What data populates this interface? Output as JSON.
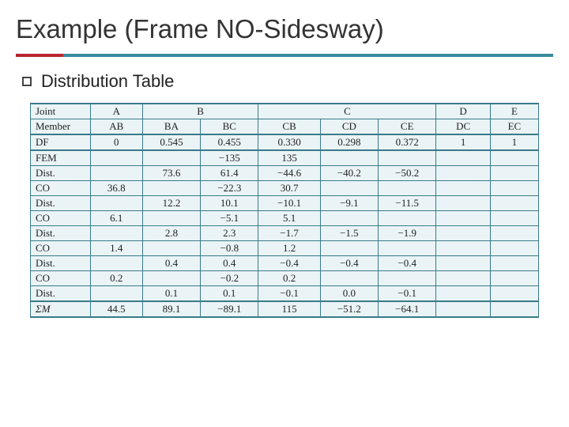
{
  "title": "Example (Frame NO-Sidesway)",
  "bullet": "Distribution Table",
  "headers": {
    "joint": "Joint",
    "member": "Member",
    "df": "DF",
    "fem": "FEM",
    "dist": "Dist.",
    "co": "CO",
    "sum": "ΣM"
  },
  "joints": {
    "a": "A",
    "b": "B",
    "c": "C",
    "d": "D",
    "e": "E"
  },
  "members": {
    "ab": "AB",
    "ba": "BA",
    "bc": "BC",
    "cb": "CB",
    "cd": "CD",
    "ce": "CE",
    "dc": "DC",
    "ec": "EC"
  },
  "df": {
    "ab": "0",
    "ba": "0.545",
    "bc": "0.455",
    "cb": "0.330",
    "cd": "0.298",
    "ce": "0.372",
    "dc": "1",
    "ec": "1"
  },
  "fem": {
    "bc": "−135",
    "cb": "135"
  },
  "dist1": {
    "ba": "73.6",
    "bc": "61.4",
    "cb": "−44.6",
    "cd": "−40.2",
    "ce": "−50.2"
  },
  "co1": {
    "ab": "36.8",
    "bc": "−22.3",
    "cb": "30.7"
  },
  "dist2": {
    "ba": "12.2",
    "bc": "10.1",
    "cb": "−10.1",
    "cd": "−9.1",
    "ce": "−11.5"
  },
  "co2": {
    "ab": "6.1",
    "bc": "−5.1",
    "cb": "5.1"
  },
  "dist3": {
    "ba": "2.8",
    "bc": "2.3",
    "cb": "−1.7",
    "cd": "−1.5",
    "ce": "−1.9"
  },
  "co3": {
    "ab": "1.4",
    "bc": "−0.8",
    "cb": "1.2"
  },
  "dist4": {
    "ba": "0.4",
    "bc": "0.4",
    "cb": "−0.4",
    "cd": "−0.4",
    "ce": "−0.4"
  },
  "co4": {
    "ab": "0.2",
    "bc": "−0.2",
    "cb": "0.2"
  },
  "dist5": {
    "ba": "0.1",
    "bc": "0.1",
    "cb": "−0.1",
    "cd": "0.0",
    "ce": "−0.1"
  },
  "summ": {
    "ab": "44.5",
    "ba": "89.1",
    "bc": "−89.1",
    "cb": "115",
    "cd": "−51.2",
    "ce": "−64.1"
  }
}
